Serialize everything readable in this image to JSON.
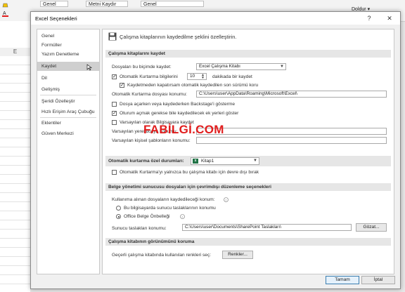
{
  "background": {
    "ribbon_font": "Metni Kaydır",
    "ribbon_style": "Genel",
    "ribbon_format_left": "Genel",
    "ribbon_fill": "Doldur",
    "ribbon_arrow": "▾",
    "column_header": "E"
  },
  "dialog": {
    "title": "Excel Seçenekleri",
    "help": "?",
    "close": "✕"
  },
  "nav": {
    "items": [
      {
        "label": "Genel"
      },
      {
        "label": "Formüller"
      },
      {
        "label": "Yazım Denetleme"
      },
      {
        "label": "Kaydet"
      },
      {
        "label": "Dil"
      },
      {
        "label": "Gelişmiş"
      },
      {
        "label": "Şeridi Özelleştir"
      },
      {
        "label": "Hızlı Erişim Araç Çubuğu"
      },
      {
        "label": "Eklentiler"
      },
      {
        "label": "Güven Merkezi"
      }
    ],
    "selected_index": 3
  },
  "header": {
    "text": "Çalışma kitaplarının kaydedilme şeklini özelleştirin.",
    "icon": "floppy-disk-icon"
  },
  "save_section": {
    "title": "Çalışma kitaplarını kaydet",
    "format_label": "Dosyaları bu biçimde kaydet:",
    "format_value": "Excel Çalışma Kitabı",
    "autorecover_label": "Otomatik Kurtarma bilgilerini",
    "autorecover_minutes": "10",
    "autorecover_suffix": "dakikada bir kaydet",
    "keep_last_label": "Kaydetmeden kapatırsam otomatik kaydedilen son sürümü koru",
    "autorecover_location_label": "Otomatik Kurtarma dosyası konumu:",
    "autorecover_location_value": "C:\\Users\\user\\AppData\\Roaming\\Microsoft\\Excel\\",
    "backstage_label": "Dosya açarken veya kaydederken Backstage'i gösterme",
    "signin_label": "Oturum açmak gerekse bile kaydedilecek ek yerleri göster",
    "default_computer_label": "Varsayılan olarak Bilgisayara kaydet",
    "default_local_label": "Varsayılan yerel dosya konumu:",
    "default_local_value": "",
    "personal_templates_label": "Varsayılan kişisel şablonların konumu:",
    "personal_templates_value": ""
  },
  "autorecover_exceptions": {
    "title": "Otomatik kurtarma özel durumları:",
    "workbook": "Kitap1",
    "disable_label": "Otomatik Kurtarma'yı yalnızca bu çalışma kitabı için devre dışı bırak"
  },
  "server_section": {
    "title": "Belge yönetimi sunucusu dosyaları için çevrimdışı düzenleme seçenekleri",
    "location_label": "Kullanıma alınan dosyaların kaydedileceği konum:",
    "option_computer": "Bu bilgisayarda sunucu taslaklarının konumu",
    "option_cache": "Office Belge Önbelleği",
    "drafts_label": "Sunucu taslakları konumu:",
    "drafts_value": "C:\\Users\\user\\Documents\\SharePoint Taslakları\\",
    "browse_label": "Gözat..."
  },
  "appearance_section": {
    "title": "Çalışma kitabının görünümünü koruma",
    "colors_label": "Geçerli çalışma kitabında kullanılan renkleri seç:",
    "colors_button": "Renkler..."
  },
  "footer": {
    "ok": "Tamam",
    "cancel": "İptal"
  },
  "watermark": "FABİLGİ.COM",
  "colors": {
    "accent": "#3c7fb1",
    "watermark": "#e11d1d",
    "excel_green": "#217346"
  }
}
